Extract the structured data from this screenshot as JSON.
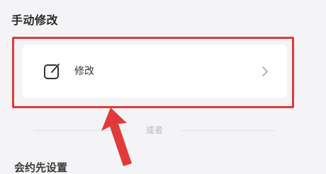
{
  "section": {
    "title": "手动修改"
  },
  "option": {
    "label": "修改",
    "icon": "edit-icon",
    "chevron_icon": "chevron-right-icon"
  },
  "divider": {
    "text": "或者"
  },
  "next_section": {
    "title_partial": "会约先设置"
  },
  "colors": {
    "highlight": "#e23a3a",
    "background": "#f4f4f6",
    "card": "#ffffff"
  }
}
